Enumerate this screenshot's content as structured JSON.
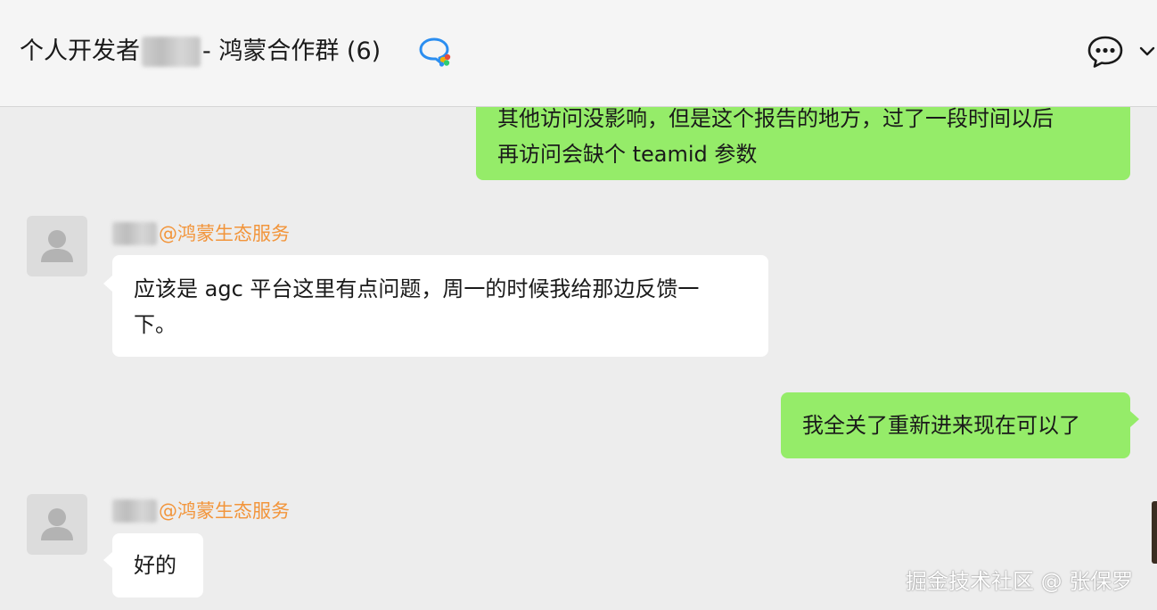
{
  "header": {
    "title_prefix": "个人开发者",
    "title_suffix": "- 鸿蒙合作群 (6)",
    "icons": [
      "group-chat-icon",
      "chat-bubble-icon",
      "chevron-down-icon"
    ]
  },
  "messages": [
    {
      "from": "self",
      "lines": [
        "其他访问没影响，但是这个报告的地方，过了一段时间以后",
        "再访问会缺个 teamid 参数"
      ]
    },
    {
      "from": "other",
      "sender": "@鸿蒙生态服务",
      "lines": [
        "应该是 agc 平台这里有点问题，周一的时候我给那边反馈一",
        "下。"
      ]
    },
    {
      "from": "self",
      "lines": [
        "我全关了重新进来现在可以了"
      ]
    },
    {
      "from": "other",
      "sender": "@鸿蒙生态服务",
      "lines": [
        "好的"
      ]
    }
  ],
  "watermark": "掘金技术社区 @ 张保罗",
  "colors": {
    "self_bubble": "#95ec69",
    "other_bubble": "#ffffff",
    "sender_name": "#f2953b",
    "background": "#ededed"
  }
}
